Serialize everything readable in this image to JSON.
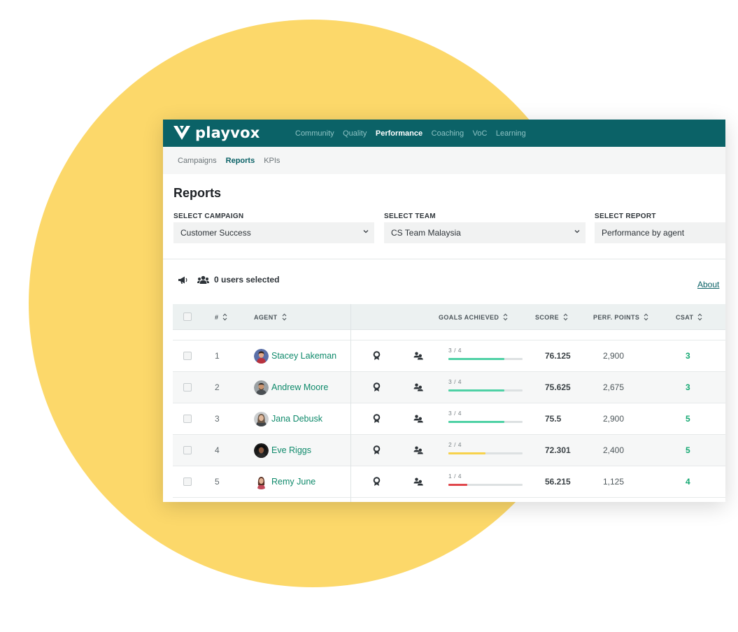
{
  "brand": {
    "name": "playvox",
    "color": "#0b6267",
    "accent": "#fcd86a"
  },
  "main_nav": [
    {
      "label": "Community",
      "active": false
    },
    {
      "label": "Quality",
      "active": false
    },
    {
      "label": "Performance",
      "active": true
    },
    {
      "label": "Coaching",
      "active": false
    },
    {
      "label": "VoC",
      "active": false
    },
    {
      "label": "Learning",
      "active": false
    }
  ],
  "sub_nav": [
    {
      "label": "Campaigns",
      "active": false
    },
    {
      "label": "Reports",
      "active": true
    },
    {
      "label": "KPIs",
      "active": false
    }
  ],
  "page_title": "Reports",
  "filters": {
    "campaign": {
      "label": "SELECT CAMPAIGN",
      "value": "Customer Success"
    },
    "team": {
      "label": "SELECT TEAM",
      "value": "CS Team Malaysia"
    },
    "report": {
      "label": "SELECT REPORT",
      "value": "Performance by agent"
    }
  },
  "toolbar": {
    "users_selected": "0 users selected",
    "about_link": "About"
  },
  "table": {
    "headers": {
      "number": "#",
      "agent": "AGENT",
      "goals": "GOALS ACHIEVED",
      "score": "SCORE",
      "perf": "PERF. POINTS",
      "csat": "CSAT"
    },
    "rows": [
      {
        "num": "1",
        "agent": "Stacey Lakeman",
        "goals": "3 / 4",
        "goals_fraction": 0.75,
        "goals_color": "#4fd1a5",
        "score": "76.125",
        "perf": "2,900",
        "csat": "3"
      },
      {
        "num": "2",
        "agent": "Andrew Moore",
        "goals": "3 / 4",
        "goals_fraction": 0.75,
        "goals_color": "#4fd1a5",
        "score": "75.625",
        "perf": "2,675",
        "csat": "3"
      },
      {
        "num": "3",
        "agent": "Jana Debusk",
        "goals": "3 / 4",
        "goals_fraction": 0.75,
        "goals_color": "#4fd1a5",
        "score": "75.5",
        "perf": "2,900",
        "csat": "5"
      },
      {
        "num": "4",
        "agent": "Eve Riggs",
        "goals": "2 / 4",
        "goals_fraction": 0.5,
        "goals_color": "#f7d24c",
        "score": "72.301",
        "perf": "2,400",
        "csat": "5"
      },
      {
        "num": "5",
        "agent": "Remy June",
        "goals": "1 / 4",
        "goals_fraction": 0.25,
        "goals_color": "#e0474c",
        "score": "56.215",
        "perf": "1,125",
        "csat": "4"
      }
    ]
  },
  "icons": {
    "logo": "playvox-v-logo-icon",
    "announce": "megaphone-icon",
    "users": "users-group-icon",
    "sort": "sort-arrows-icon",
    "chevron": "chevron-down-icon",
    "badge": "award-badge-icon",
    "team": "team-icon"
  }
}
